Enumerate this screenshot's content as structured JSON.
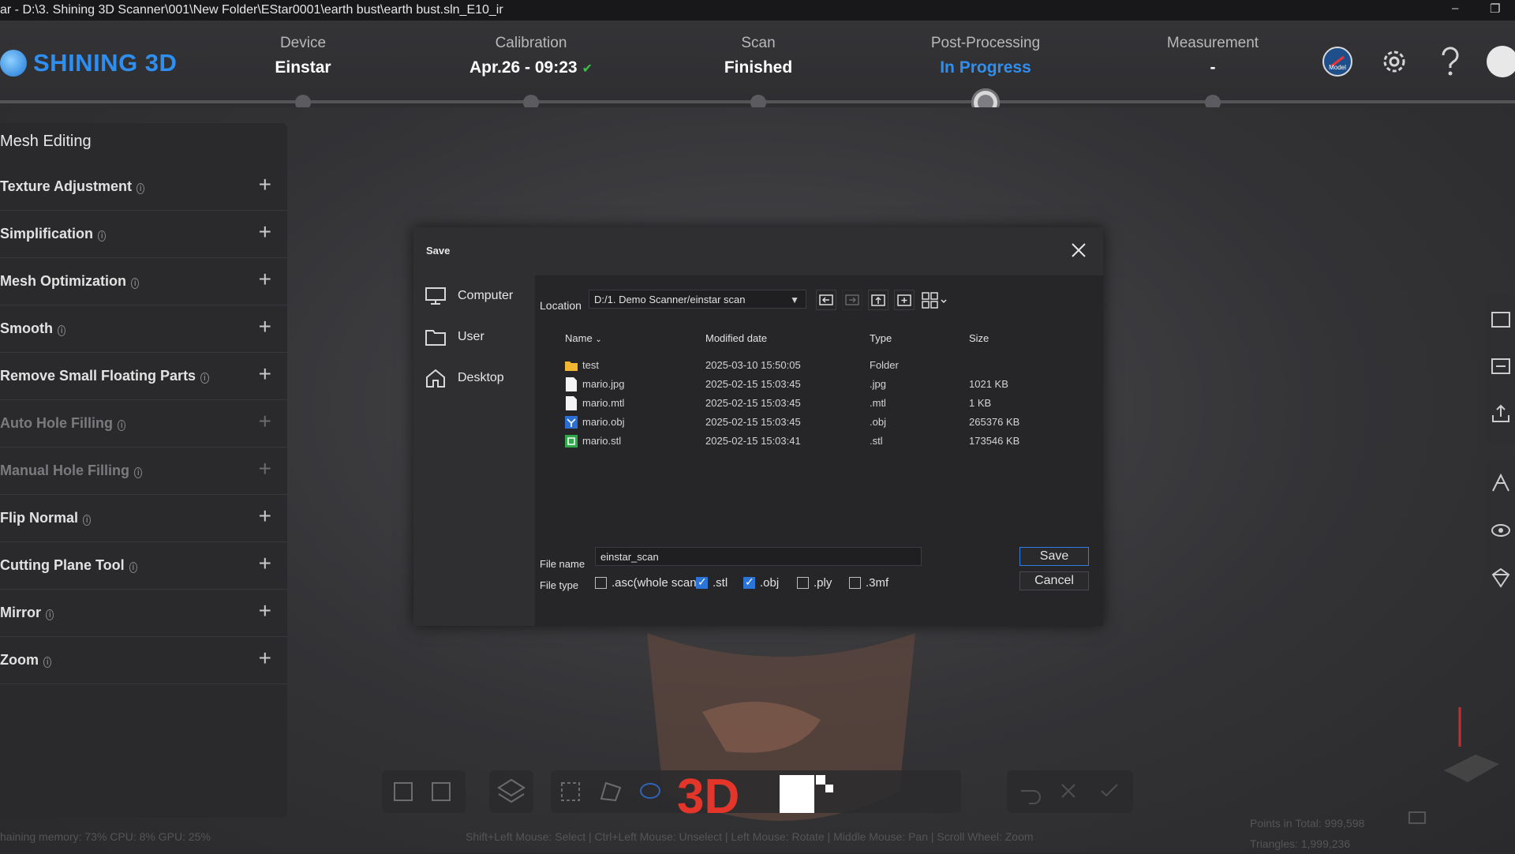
{
  "window": {
    "title": "ar  -  D:\\3. Shining 3D Scanner\\001\\New Folder\\EStar0001\\earth bust\\earth bust.sln_E10_ir",
    "minimize": "–",
    "restore": "❐"
  },
  "logo": {
    "text": "SHINING 3D"
  },
  "steps": [
    {
      "label": "Device",
      "value": "Einstar"
    },
    {
      "label": "Calibration",
      "value": "Apr.26 - 09:23",
      "check": "✔"
    },
    {
      "label": "Scan",
      "value": "Finished"
    },
    {
      "label": "Post-Processing",
      "value": "In Progress"
    },
    {
      "label": "Measurement",
      "value": "-"
    }
  ],
  "sidebar": {
    "title": "Mesh Editing",
    "info_glyph": "i",
    "plus_glyph": "+",
    "tools": [
      {
        "label": "Texture Adjustment",
        "enabled": true
      },
      {
        "label": "Simplification",
        "enabled": true
      },
      {
        "label": "Mesh Optimization",
        "enabled": true
      },
      {
        "label": "Smooth",
        "enabled": true
      },
      {
        "label": "Remove Small Floating Parts",
        "enabled": true
      },
      {
        "label": "Auto Hole Filling",
        "enabled": false
      },
      {
        "label": "Manual Hole Filling",
        "enabled": false
      },
      {
        "label": "Flip Normal",
        "enabled": true
      },
      {
        "label": "Cutting Plane Tool",
        "enabled": true
      },
      {
        "label": "Mirror",
        "enabled": true
      },
      {
        "label": "Zoom",
        "enabled": true
      }
    ]
  },
  "dialog": {
    "title": "Save",
    "places": [
      "Computer",
      "User",
      "Desktop"
    ],
    "location_label": "Location",
    "location_value": "D:/1. Demo Scanner/einstar scan",
    "columns": {
      "name": "Name",
      "sort_glyph": "⌄",
      "modified": "Modified date",
      "type": "Type",
      "size": "Size"
    },
    "files": [
      {
        "name": "test",
        "modified": "2025-03-10 15:50:05",
        "type": "Folder",
        "size": "",
        "icon": "folder-icon"
      },
      {
        "name": "mario.jpg",
        "modified": "2025-02-15 15:03:45",
        "type": ".jpg",
        "size": "1021 KB",
        "icon": "file-icon"
      },
      {
        "name": "mario.mtl",
        "modified": "2025-02-15 15:03:45",
        "type": ".mtl",
        "size": "1 KB",
        "icon": "file-icon"
      },
      {
        "name": "mario.obj",
        "modified": "2025-02-15 15:03:45",
        "type": ".obj",
        "size": "265376 KB",
        "icon": "obj-file-icon"
      },
      {
        "name": "mario.stl",
        "modified": "2025-02-15 15:03:41",
        "type": ".stl",
        "size": "173546 KB",
        "icon": "stl-file-icon"
      }
    ],
    "filename_label": "File name",
    "filename_value": "einstar_scan",
    "filetype_label": "File type",
    "filetypes": [
      {
        "label": ".asc(whole scan)",
        "checked": false
      },
      {
        "label": ".stl",
        "checked": true
      },
      {
        "label": ".obj",
        "checked": true
      },
      {
        "label": ".ply",
        "checked": false
      },
      {
        "label": ".3mf",
        "checked": false
      }
    ],
    "save_label": "Save",
    "cancel_label": "Cancel"
  },
  "status": {
    "left": "haining memory: 73% CPU: 8% GPU: 25%",
    "hint": "Shift+Left Mouse: Select | Ctrl+Left Mouse: Unselect | Left Mouse: Rotate | Middle Mouse: Pan | Scroll Wheel: Zoom",
    "points": "Points in Total: 999,598",
    "triangles": "Triangles: 1,999,236"
  },
  "watermark": "3D",
  "colors": {
    "accent": "#2f8ff0",
    "check": "#3cc24a",
    "panel": "#2a2a2c"
  }
}
